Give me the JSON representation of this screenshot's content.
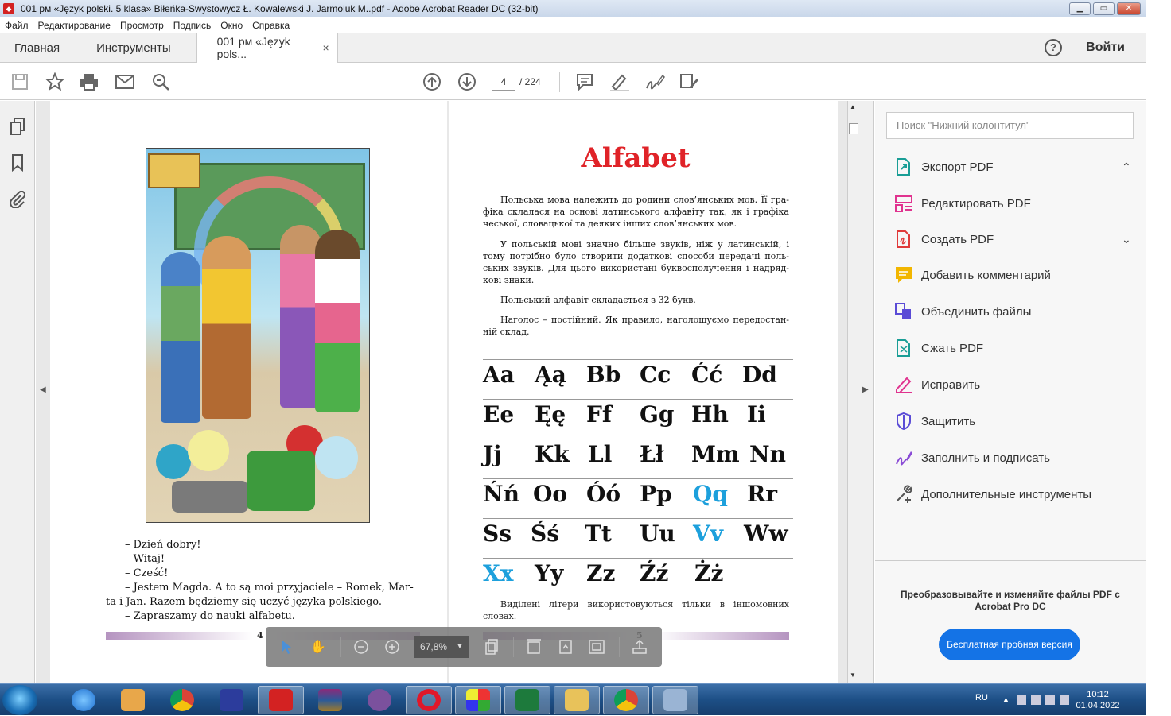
{
  "window": {
    "title": "001 рм «Język polski. 5 klasa» Biłeńka-Swystowycz Ł. Kowalewski J. Jarmoluk M..pdf - Adobe Acrobat Reader DC (32-bit)",
    "app_icon": "acrobat-icon",
    "controls": [
      "▁",
      "▭",
      "✕"
    ]
  },
  "menu": [
    "Файл",
    "Редактирование",
    "Просмотр",
    "Подпись",
    "Окно",
    "Справка"
  ],
  "tabs": {
    "home": "Главная",
    "tools": "Инструменты",
    "document": "001 рм «Język pols...",
    "close": "×"
  },
  "header_right": {
    "help": "?",
    "login": "Войти"
  },
  "toolbar": {
    "page_current": "4",
    "page_total": "/ 224",
    "icons": [
      "save-icon",
      "star-icon",
      "print-icon",
      "mail-icon",
      "search-zoom-icon",
      "arrow-up-icon",
      "arrow-down-icon",
      "comment-icon",
      "highlight-icon",
      "sign-icon",
      "edit-icon"
    ]
  },
  "left_page": {
    "dialog": [
      "– Dzień dobry!",
      "– Witaj!",
      "– Cześć!",
      "– Jestem Magda. A to są moi przyjaciele – Romek, Mar-",
      "ta i Jan. Razem będziemy się uczyć języka polskiego.",
      "– Zapraszamy do nauki alfabetu."
    ],
    "page_number": "4"
  },
  "right_page": {
    "title": "Alfabet",
    "paragraphs": [
      "Польська мова належить до родини слов’янських мов. Її гра-фіка склалася на основі латинського алфавіту так, як і графіка чеської, словацької та деяких інших слов’янських мов.",
      "У польській мові значно більше звуків, ніж у латинській, і тому потрібно було створити додаткові способи передачі поль-ських звуків. Для цього використані буквосполучення і надряд-кові знаки.",
      "Польський алфавіт складається з 32 букв.",
      "Наголос – постійний. Як правило, наголошуємо передостан-ній склад."
    ],
    "letter_rows": [
      [
        "Aa",
        "Ąą",
        "Bb",
        "Cc",
        "Ćć",
        "Dd"
      ],
      [
        "Ee",
        "Ęę",
        "Ff",
        "Gg",
        "Hh",
        "Ii"
      ],
      [
        "Jj",
        "Kk",
        "Ll",
        "Łł",
        "Mm",
        "Nn"
      ],
      [
        "Ńń",
        "Oo",
        "Óó",
        "Pp",
        "Qq",
        "Rr"
      ],
      [
        "Ss",
        "Śś",
        "Tt",
        "Uu",
        "Vv",
        "Ww"
      ],
      [
        "Xx",
        "Yy",
        "Zz",
        "Źź",
        "Żż"
      ]
    ],
    "highlighted_letters": [
      "Qq",
      "Vv",
      "Xx"
    ],
    "highlight_color": "#1da0dc",
    "title_color": "#e02328",
    "note": "Виділені літери використовуються тільки в іншомовних словах.",
    "page_number": "5"
  },
  "floating_toolbar": {
    "zoom": "67,8%",
    "icons": [
      "select-cursor-icon",
      "hand-icon",
      "zoom-out-icon",
      "zoom-in-icon",
      "page-view-icon",
      "fit-width-icon",
      "rotate-icon",
      "fullscreen-icon",
      "share-icon"
    ]
  },
  "right_panel": {
    "search_placeholder": "Поиск \"Нижний колонтитул\"",
    "tools": [
      {
        "label": "Экспорт PDF",
        "icon": "export-pdf-icon",
        "color": "#1a9e96",
        "chevron": "⌃"
      },
      {
        "label": "Редактировать PDF",
        "icon": "edit-pdf-icon",
        "color": "#e0338f",
        "chevron": ""
      },
      {
        "label": "Создать PDF",
        "icon": "create-pdf-icon",
        "color": "#e03a3a",
        "chevron": "⌄"
      },
      {
        "label": "Добавить комментарий",
        "icon": "comment-icon",
        "color": "#f2b600",
        "chevron": ""
      },
      {
        "label": "Объединить файлы",
        "icon": "combine-files-icon",
        "color": "#5a4bd6",
        "chevron": ""
      },
      {
        "label": "Сжать PDF",
        "icon": "compress-pdf-icon",
        "color": "#1a9e96",
        "chevron": ""
      },
      {
        "label": "Исправить",
        "icon": "fix-icon",
        "color": "#e0338f",
        "chevron": ""
      },
      {
        "label": "Защитить",
        "icon": "shield-icon",
        "color": "#5a4bd6",
        "chevron": ""
      },
      {
        "label": "Заполнить и подписать",
        "icon": "fill-sign-icon",
        "color": "#8a4bd6",
        "chevron": ""
      },
      {
        "label": "Дополнительные инструменты",
        "icon": "more-tools-icon",
        "color": "#555555",
        "chevron": ""
      }
    ],
    "promo_text": "Преобразовывайте и изменяйте файлы PDF с Acrobat Pro DC",
    "promo_button": "Бесплатная пробная версия",
    "promo_button_color": "#1473e6"
  },
  "taskbar": {
    "apps": [
      "ie-icon",
      "media-icon",
      "chrome-icon",
      "save-disk-icon",
      "acrobat-icon",
      "winrar-icon",
      "viber-icon",
      "opera-icon",
      "paint-icon",
      "excel-icon",
      "explorer-icon",
      "chrome-icon",
      "calculator-icon"
    ],
    "active_app": "acrobat-icon",
    "language": "RU",
    "time": "10:12",
    "date": "01.04.2022"
  }
}
